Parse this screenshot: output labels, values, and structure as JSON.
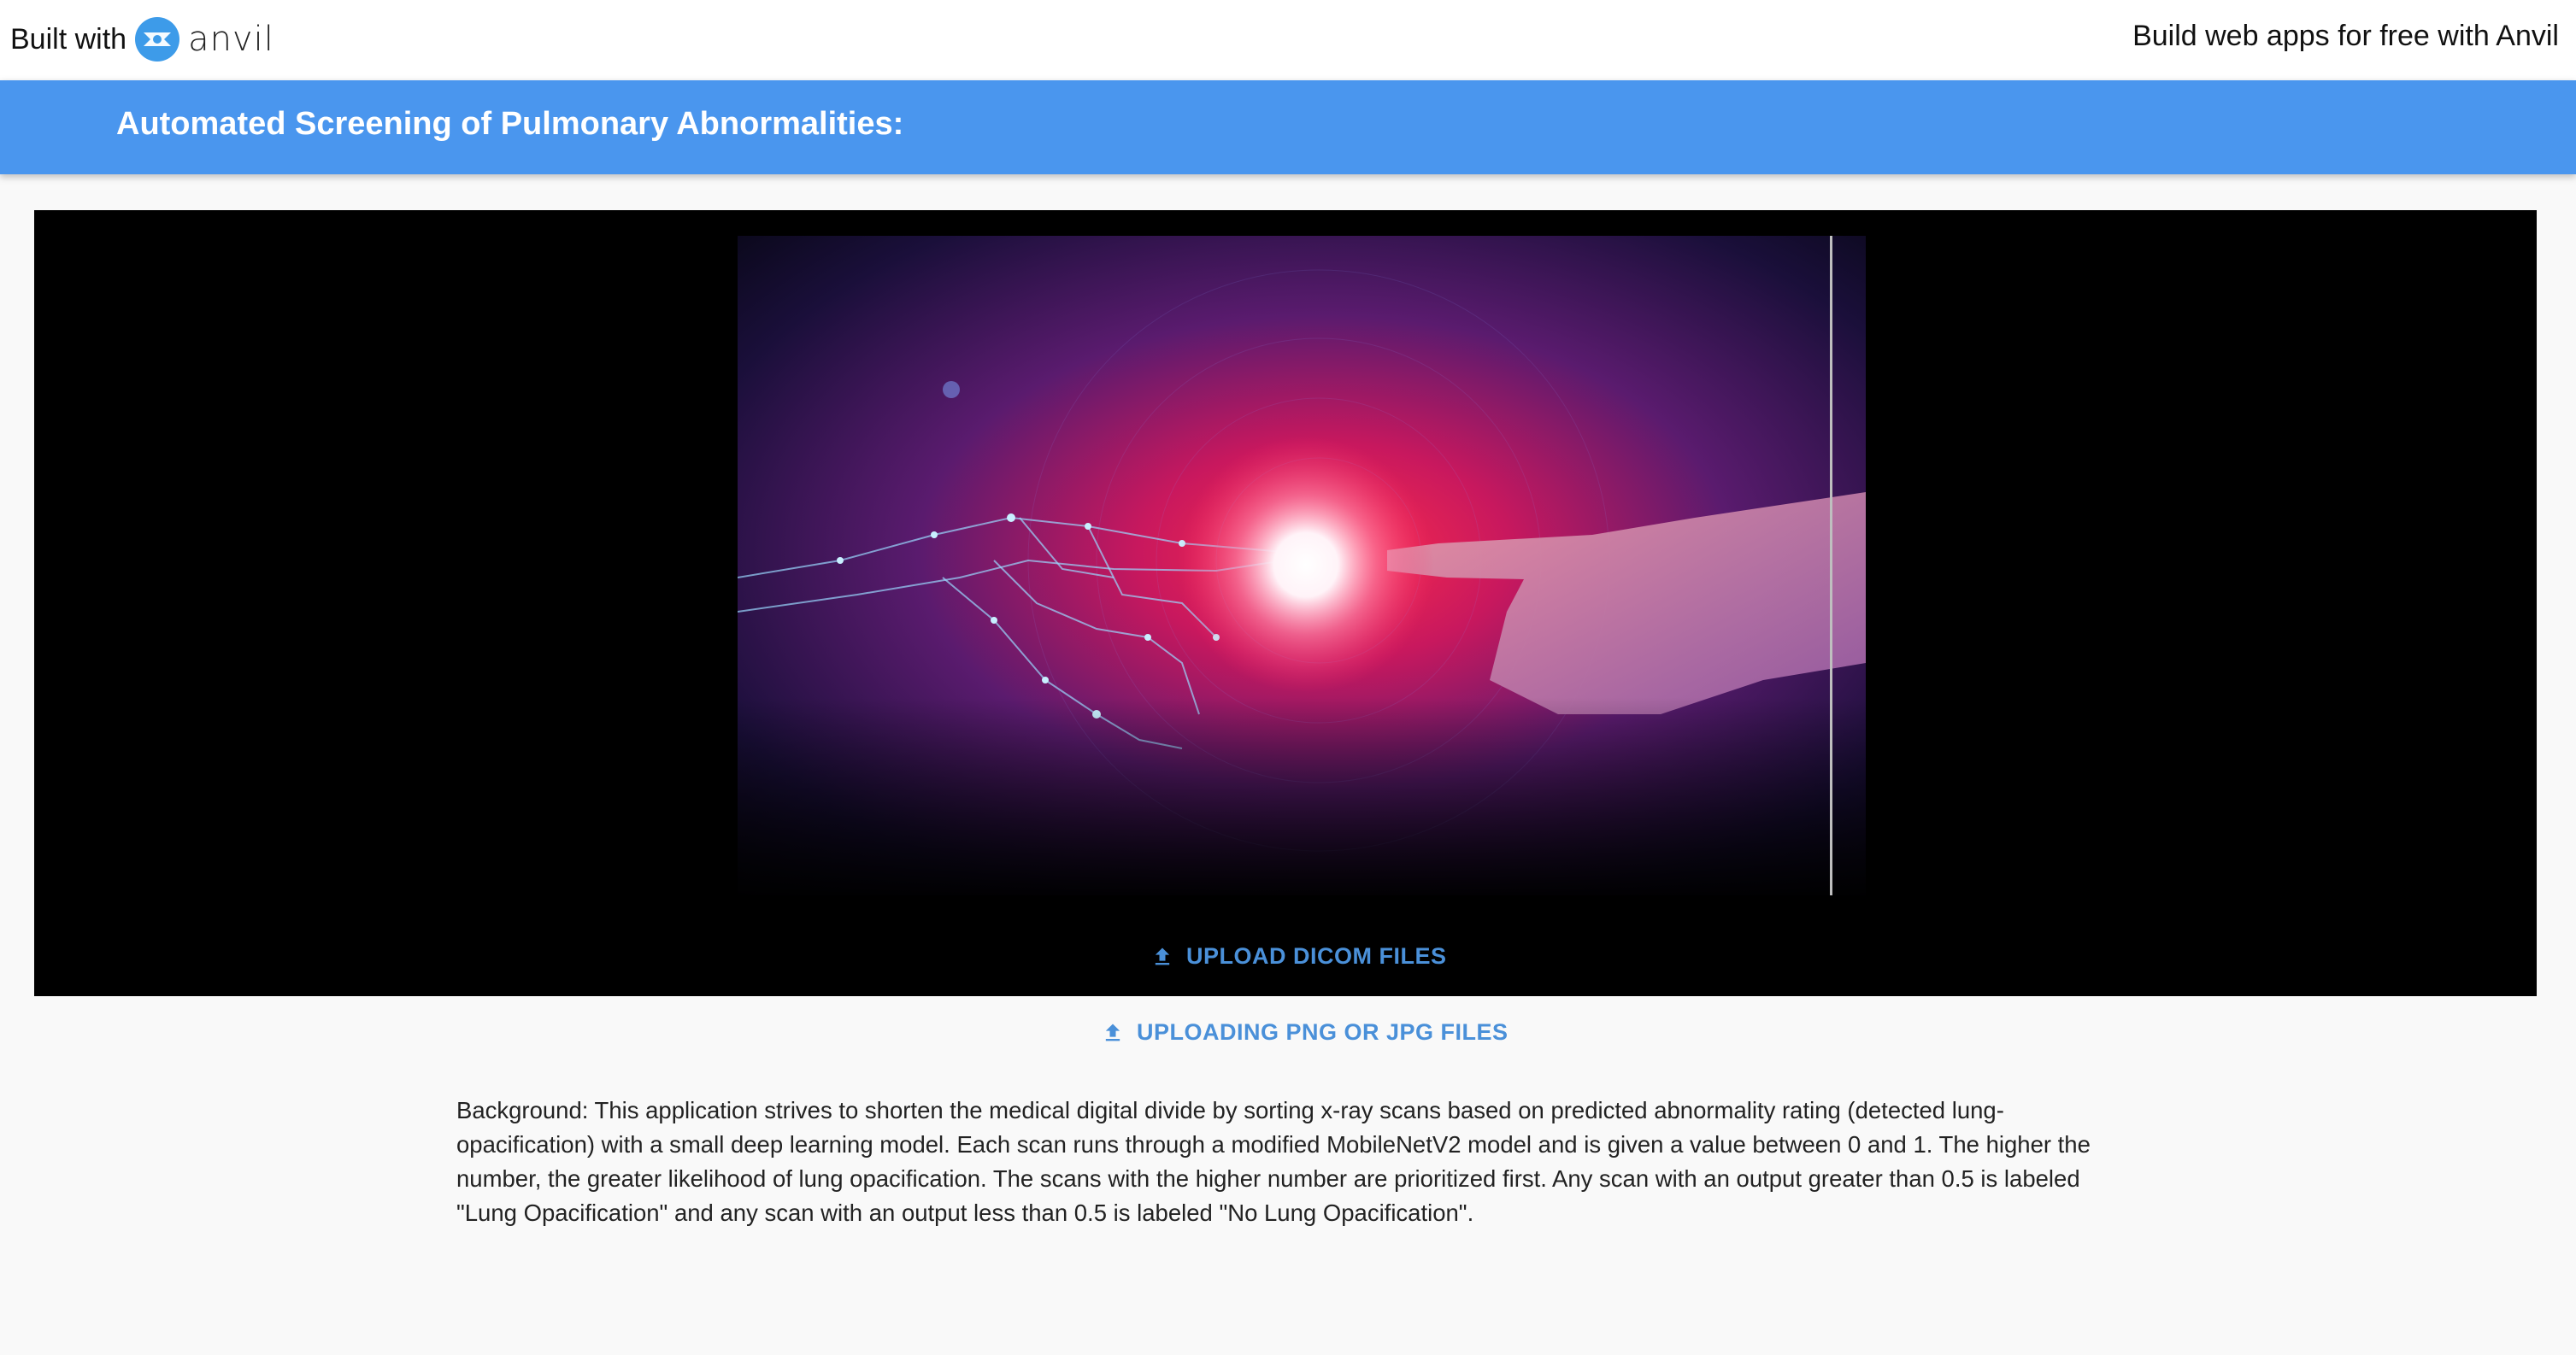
{
  "topbar": {
    "built_with_label": "Built with",
    "brand_name": "anvil",
    "promo_link": "Build web apps for free with Anvil"
  },
  "appbar": {
    "title": "Automated Screening of Pulmonary Abnormalities:"
  },
  "hero": {
    "image_icon": "robot-and-human-hand-touching-image"
  },
  "buttons": {
    "upload_dicom": "UPLOAD DICOM FILES",
    "upload_png_jpg": "UPLOADING PNG OR JPG FILES",
    "upload_icon": "upload-icon"
  },
  "description": "Background: This application strives to shorten the medical digital divide by sorting x-ray scans based on predicted abnormality rating (detected lung-opacification) with a small deep learning model. Each scan runs through a modified MobileNetV2 model and is given a value between 0 and 1. The higher the number, the greater likelihood of lung opacification. The scans with the higher number are prioritized first. Any scan with an output greater than 0.5 is labeled \"Lung Opacification\" and any scan with an output less than 0.5 is labeled \"No Lung Opacification\".",
  "colors": {
    "appbar": "#4a96ee",
    "button_text": "#4a90d9",
    "hero_background": "#000000",
    "page_background": "#f9f9f9"
  }
}
